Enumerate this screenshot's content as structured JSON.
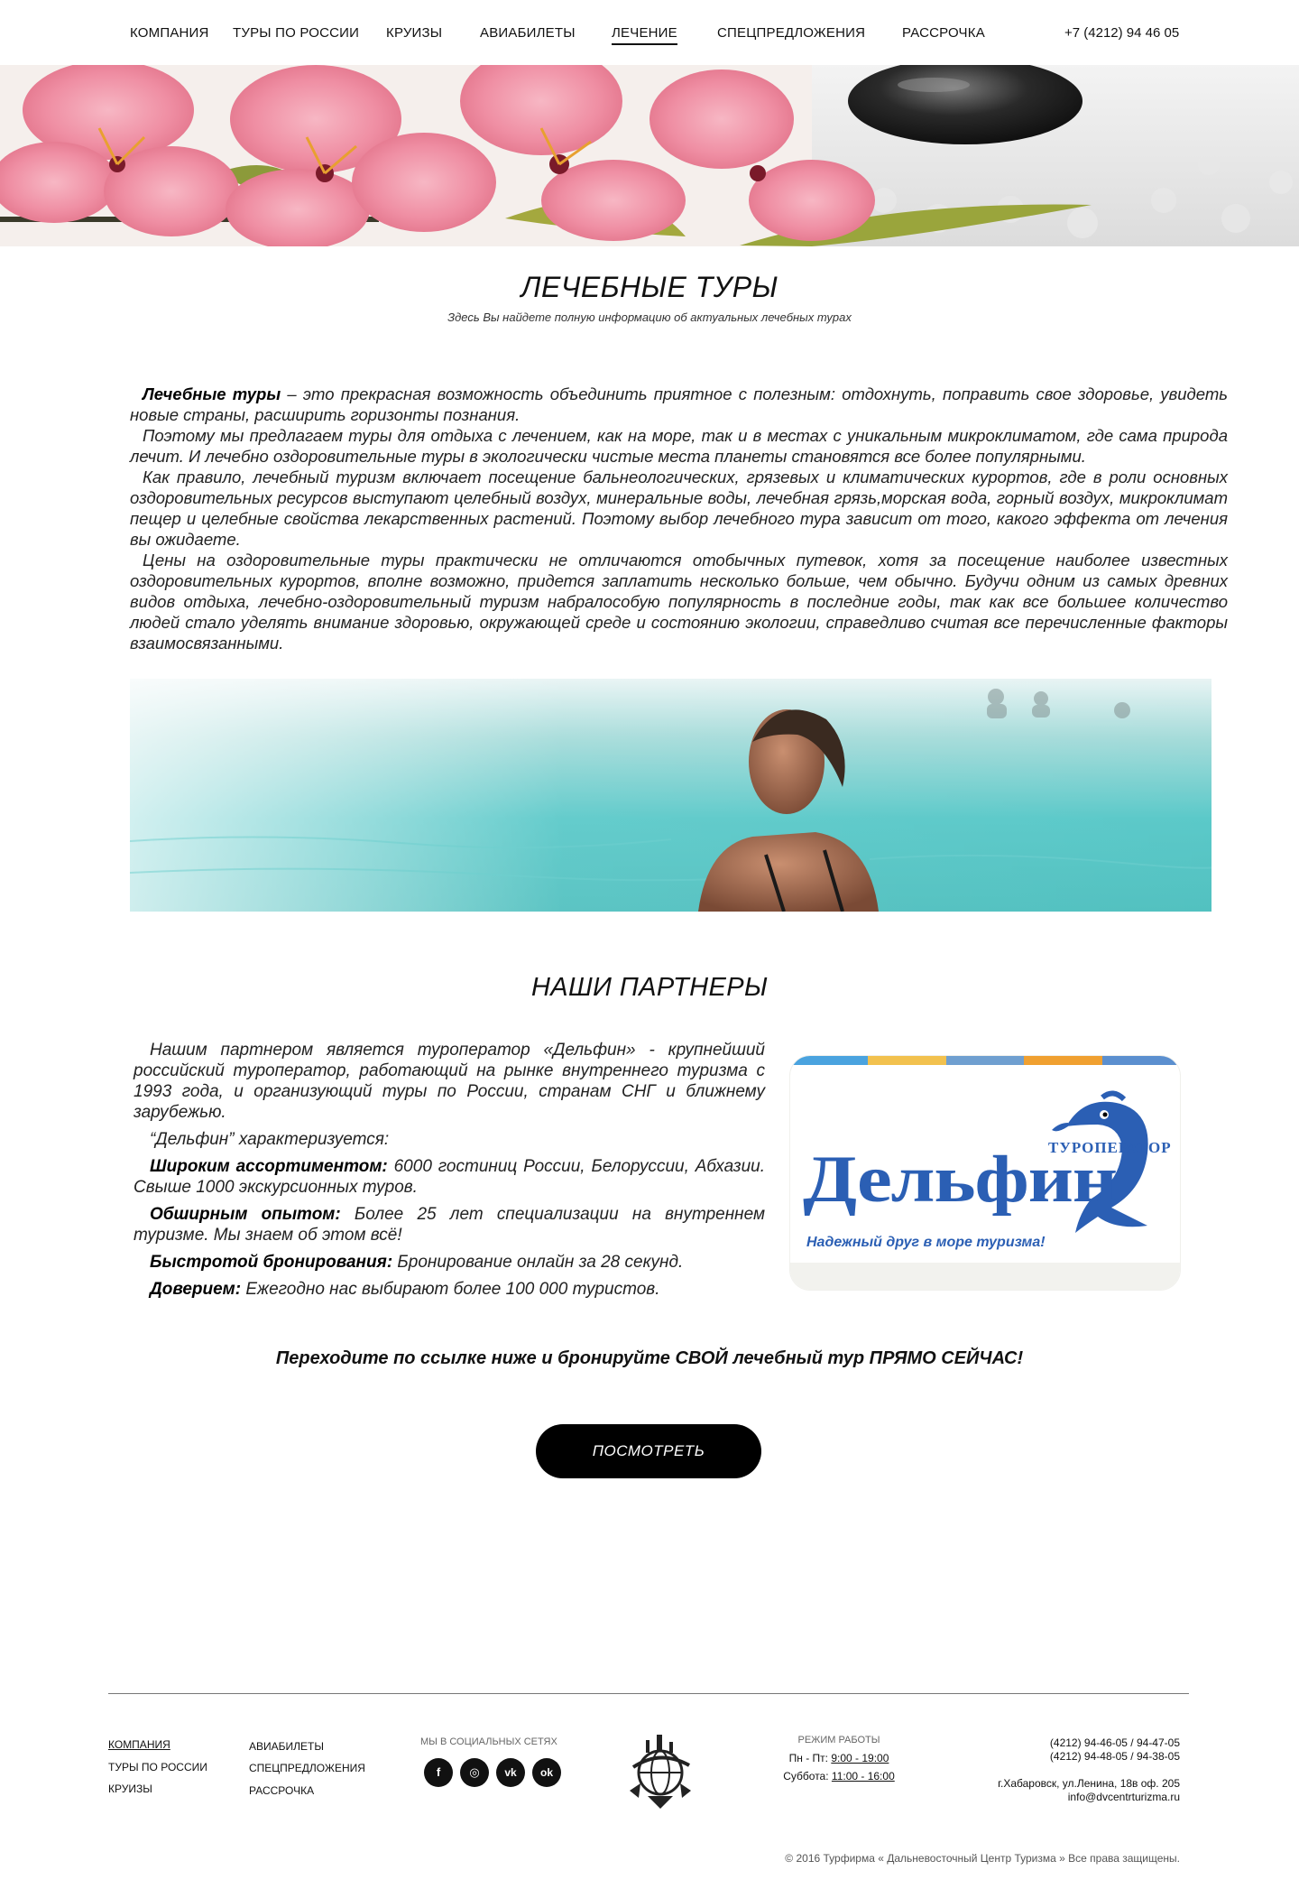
{
  "nav": {
    "items": [
      {
        "label": "КОМПАНИЯ"
      },
      {
        "label": "ТУРЫ ПО РОССИИ"
      },
      {
        "label": "КРУИЗЫ"
      },
      {
        "label": "АВИАБИЛЕТЫ"
      },
      {
        "label": "ЛЕЧЕНИЕ",
        "active": true
      },
      {
        "label": "СПЕЦПРЕДЛОЖЕНИЯ"
      },
      {
        "label": "РАССРОЧКА"
      }
    ],
    "phone": "+7 (4212) 94 46 05"
  },
  "page": {
    "title": "ЛЕЧЕБНЫЕ ТУРЫ",
    "subtitle": "Здесь Вы найдете полную информацию об актуальных лечебных турах"
  },
  "intro": {
    "p1_bold": "Лечебные туры",
    "p1_rest": " – это прекрасная возможность объединить приятное с полезным: отдохнуть, поправить свое здоровье, увидеть новые страны, расширить горизонты познания.",
    "p2": "Поэтому мы предлагаем туры для отдыха с лечением, как на море, так и в местах с уникальным микроклиматом, где сама природа лечит. И лечебно оздоровительные туры в экологически чистые места планеты становятся все более популярными.",
    "p3": "Как правило, лечебный туризм включает посещение бальнеологических, грязевых и климатических курортов, где в роли основных оздоровительных ресурсов выступают целебный воздух, минеральные воды, лечебная грязь,морская вода, горный воздух, микроклимат пещер и целебные свойства лекарственных растений.  Поэтому выбор лечебного тура зависит от того, какого эффекта от лечения вы ожидаете.",
    "p4": "Цены на оздоровительные туры практически не отличаются отобычных путевок, хотя за посещение наиболее известных оздоровительных курортов, вполне возможно, придется заплатить несколько больше, чем обычно. Будучи одним из самых древних видов отдыха, лечебно-оздоровительный туризм набралособую популярность в последние годы, так как все большее количество людей стало уделять внимание здоровью, окружающей среде и состоянию экологии, справедливо считая все перечисленные факторы взаимосвязанными."
  },
  "partners": {
    "title": "НАШИ ПАРТНЕРЫ",
    "p1": "Нашим партнером является туроператор «Дельфин» - крупнейший российский туроператор, работающий на рынке внутреннего туризма с 1993 года, и организующий туры по России, странам СНГ и ближнему зарубежью.",
    "p2": "“Дельфин” характеризуется:",
    "f1_bold": "Широким ассортиментом:",
    "f1_rest": " 6000 гостиниц России, Белоруссии, Абхазии. Свыше 1000 экскурсионных туров.",
    "f2_bold": "Обширным опытом:",
    "f2_rest": " Более 25 лет специализации на внутреннем туризме. Мы знаем об этом всё!",
    "f3_bold": "Быстротой бронирования:",
    "f3_rest": " Бронирование онлайн за 28 секунд.",
    "f4_bold": "Доверием:",
    "f4_rest": "  Ежегодно нас выбирают более 100 000 туристов.",
    "logo": {
      "small": "ТУРОПЕРАТОР",
      "big": "Дельфин",
      "slogan": "Надежный друг в море туризма!",
      "color": "#2b5fb4",
      "stripes": [
        "#4aa3df",
        "#f2c14e",
        "#6f9fd0",
        "#f0a030",
        "#5b8fcf"
      ]
    }
  },
  "cta": {
    "text": "Переходите по ссылке ниже и бронируйте СВОЙ лечебный тур ПРЯМО СЕЙЧАС!",
    "button": "ПОСМОТРЕТЬ"
  },
  "footer": {
    "col1": [
      "КОМПАНИЯ",
      "ТУРЫ ПО РОССИИ",
      "КРУИЗЫ"
    ],
    "col2": [
      "АВИАБИЛЕТЫ",
      "СПЕЦПРЕДЛОЖЕНИЯ",
      "РАССРОЧКА"
    ],
    "social_label": "МЫ В СОЦИАЛЬНЫХ СЕТЯХ",
    "social": [
      {
        "icon": "facebook-icon",
        "glyph": "f"
      },
      {
        "icon": "instagram-icon",
        "glyph": "◎"
      },
      {
        "icon": "vk-icon",
        "glyph": "vk"
      },
      {
        "icon": "odnoklassniki-icon",
        "glyph": "ok"
      }
    ],
    "hours_title": "РЕЖИМ РАБОТЫ",
    "weekday_label": "Пн - Пт:",
    "weekday_time": "9:00 - 19:00",
    "saturday_label": "Суббота:",
    "saturday_time": "11:00 - 16:00",
    "phone1": "(4212) 94-46-05 / 94-47-05",
    "phone2": "(4212) 94-48-05 / 94-38-05",
    "address": "г.Хабаровск, ул.Ленина, 18в оф. 205",
    "email": "info@dvcentrturizma.ru",
    "copyright": "© 2016 Турфирма « Дальневосточный Центр Туризма » Все права защищены."
  }
}
